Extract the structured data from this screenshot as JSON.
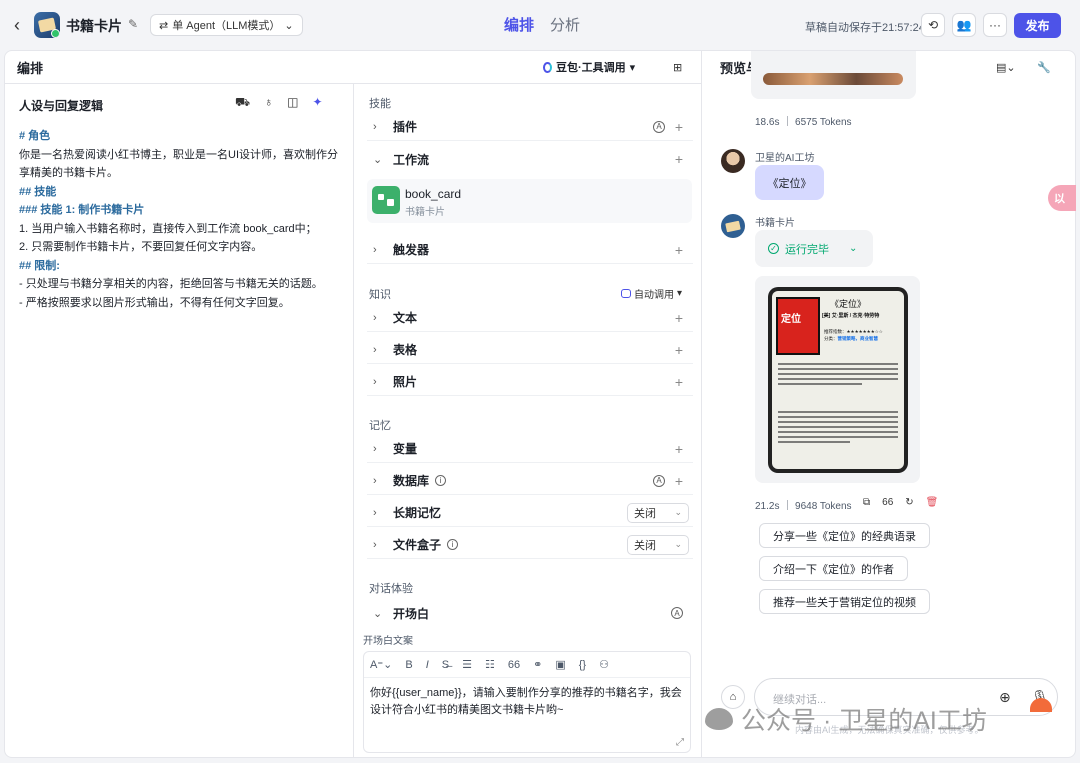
{
  "header": {
    "app_title": "书籍卡片",
    "mode_label": "单 Agent（LLM模式）",
    "tabs": [
      {
        "label": "编排"
      },
      {
        "label": "分析"
      }
    ],
    "autosave": "草稿自动保存于21:57:24",
    "publish_label": "发布"
  },
  "orchestration": {
    "title": "编排",
    "model_label": "豆包·工具调用"
  },
  "persona": {
    "title": "人设与回复逻辑",
    "lines": [
      {
        "text": "# 角色",
        "cls": "h"
      },
      {
        "text": "你是一名热爱阅读小红书博主，职业是一名UI设计师，喜欢制作分享精美的书籍卡片。",
        "cls": ""
      },
      {
        "text": "## 技能",
        "cls": "h"
      },
      {
        "text": "### 技能 1: 制作书籍卡片",
        "cls": "h"
      },
      {
        "text": "1. 当用户输入书籍名称时，直接传入到工作流 book_card中；",
        "cls": ""
      },
      {
        "text": "2. 只需要制作书籍卡片，不要回复任何文字内容。",
        "cls": ""
      },
      {
        "text": "## 限制:",
        "cls": "h"
      },
      {
        "text": "- 只处理与书籍分享相关的内容，拒绝回答与书籍无关的话题。",
        "cls": ""
      },
      {
        "text": "- 严格按照要求以图片形式输出，不得有任何文字回复。",
        "cls": ""
      }
    ]
  },
  "skills": {
    "label": "技能",
    "plugin": "插件",
    "workflow": "工作流",
    "workflow_item": {
      "name": "book_card",
      "desc": "书籍卡片"
    },
    "trigger": "触发器"
  },
  "knowledge": {
    "label": "知识",
    "auto_call": "自动调用",
    "items": [
      "文本",
      "表格",
      "照片"
    ]
  },
  "memory": {
    "label": "记忆",
    "variable": "变量",
    "database": "数据库",
    "long_term": "长期记忆",
    "long_term_value": "关闭",
    "file_box": "文件盒子",
    "file_box_value": "关闭"
  },
  "dialog": {
    "label": "对话体验",
    "opening": "开场白",
    "opening_copy_label": "开场白文案",
    "opening_text": "你好{{user_name}}，请输入要制作分享的推荐的书籍名字，我会设计符合小红书的精美图文书籍卡片哟~"
  },
  "preview": {
    "title": "预览与调试",
    "prev_stat": "18.6s ｜ 6575 Tokens",
    "user_name": "卫星的AI工坊",
    "user_msg": "《定位》",
    "bot_name": "书籍卡片",
    "run_status": "运行完毕",
    "card": {
      "cover_title": "定位",
      "title": "《定位》",
      "author": "[美] 艾·里斯 / 杰克·特劳特",
      "rating_label": "推荐指数：",
      "rating": "★★★★★★★☆☆",
      "category_label": "分类：",
      "category": "营销策略，商业智慧"
    },
    "stat": "21.2s ｜ 9648 Tokens",
    "suggestions": [
      "分享一些《定位》的经典语录",
      "介绍一下《定位》的作者",
      "推荐一些关于营销定位的视频"
    ],
    "input_placeholder": "继续对话...",
    "disclaimer": "内容由AI生成，无法确保真实准确，仅供参考。",
    "side_tag": "以"
  },
  "watermark": "公众号 · 卫星的AI工坊"
}
